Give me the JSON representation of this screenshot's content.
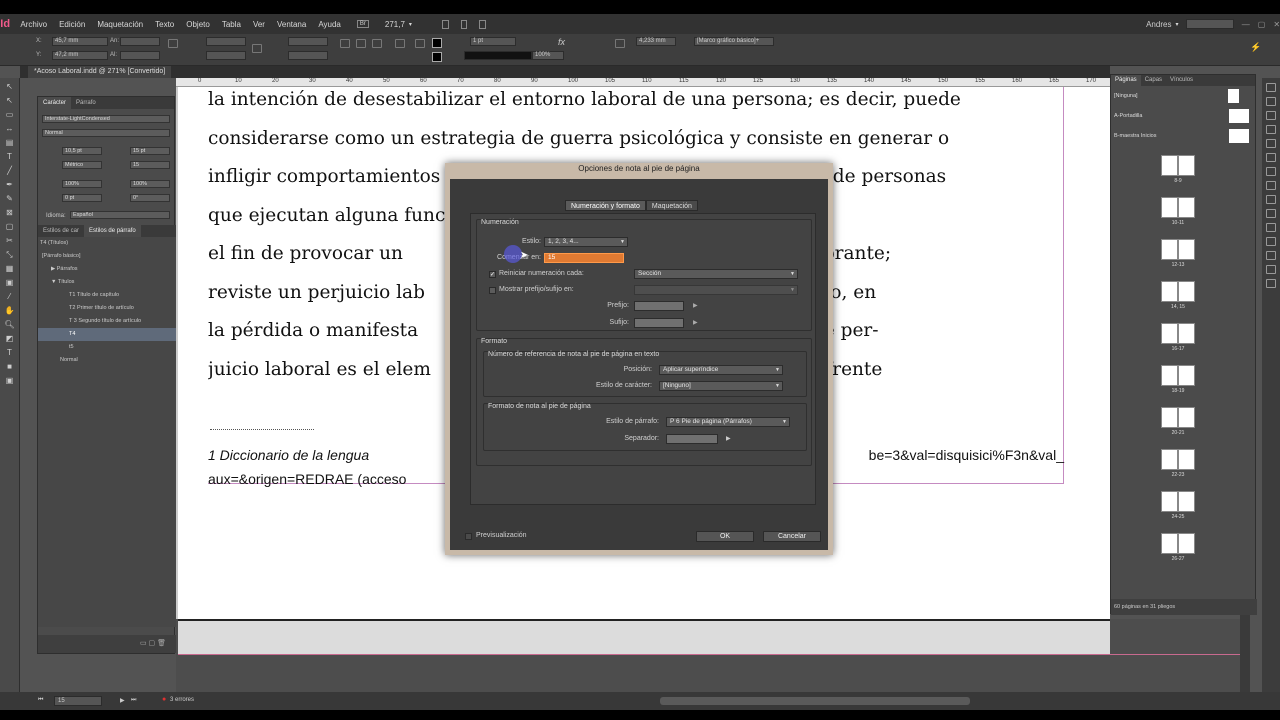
{
  "app": {
    "logo": "Id",
    "user": "Andres",
    "zoom": "271,7"
  },
  "menu": [
    "Archivo",
    "Edición",
    "Maquetación",
    "Texto",
    "Objeto",
    "Tabla",
    "Ver",
    "Ventana",
    "Ayuda"
  ],
  "control": {
    "x_label": "X:",
    "x_value": "45,7 mm",
    "y_label": "Y:",
    "y_value": "47,2 mm",
    "w_label": "An:",
    "h_label": "Al:",
    "stroke_value": "1 pt",
    "opacity_value": "100%",
    "size_value": "4,233 mm",
    "frame_style": "[Marco gráfico básico]+"
  },
  "document_tab": "*Acoso Laboral.indd @ 271% [Convertido]",
  "ruler_ticks": [
    "0",
    "10",
    "20",
    "30",
    "40",
    "50",
    "60",
    "70",
    "80",
    "90",
    "100",
    "105",
    "110",
    "115",
    "120",
    "125",
    "130",
    "135",
    "140",
    "145",
    "150",
    "155",
    "160",
    "165",
    "170"
  ],
  "left_panel": {
    "tab_char": "Carácter",
    "tab_par": "Párrafo",
    "font_family": "Interstate-LightCondensed",
    "font_style": "Normal",
    "font_size": "10,5 pt",
    "leading": "15 pt",
    "kerning": "Métrico",
    "tracking": "15",
    "vscale": "100%",
    "hscale": "100%",
    "baseline": "0 pt",
    "skew": "0°",
    "language_label": "Idioma:",
    "language": "Español",
    "styles_tab_char": "Estilos de car",
    "styles_tab_par": "Estilos de párrafo",
    "current_style": "T4 (Títulos)",
    "styles": [
      {
        "label": "[Párrafo básico]",
        "indent": 0,
        "sel": false
      },
      {
        "label": "▶ Párrafos",
        "indent": 1,
        "sel": false
      },
      {
        "label": "▼ Títulos",
        "indent": 1,
        "sel": false
      },
      {
        "label": "T1 Título de capítulo",
        "indent": 3,
        "sel": false
      },
      {
        "label": "T2 Primer título de artículo",
        "indent": 3,
        "sel": false
      },
      {
        "label": "T 3 Segundo título de artículo",
        "indent": 3,
        "sel": false
      },
      {
        "label": "T4",
        "indent": 3,
        "sel": true
      },
      {
        "label": "t5",
        "indent": 3,
        "sel": false
      },
      {
        "label": "Normal",
        "indent": 2,
        "sel": false
      }
    ]
  },
  "document": {
    "body_lines": [
      "la intención de desestabilizar el entorno laboral de una persona; es decir, puede",
      "considerarse como un estrategia de guerra psicológica y consiste en generar o",
      "infligir comportamientos agresores sobre una persona o un grupo de personas",
      "que ejecutan alguna función                        una célula laboral, con",
      "el fin de provocar un                                              mente desequilibrante;",
      "reviste un perjuicio lab                                          tivación o, incluso, en",
      "la pérdida o manifesta                                            Esta finalidad de per-",
      "juicio laboral es el elem                                         le acoso laboral frente"
    ],
    "footnote_line1": "1  Diccionario  de  la  lengua",
    "footnote_line1_end": "be=3&val=disquisici%F3n&val_",
    "footnote_line2": "aux=&origen=REDRAE (acceso"
  },
  "right_panel": {
    "tab_pages": "Páginas",
    "tab_layers": "Capas",
    "tab_links": "Vínculos",
    "masters": [
      "[Ninguna]",
      "A-Portadilla",
      "B-maestra Inicios"
    ],
    "spreads": [
      "8-9",
      "10-11",
      "12-13",
      "14, 15",
      "16-17",
      "18-19",
      "20-21",
      "22-23",
      "24-25",
      "26-27"
    ],
    "footer": "60 páginas en 31 pliegos"
  },
  "status": {
    "page": "15",
    "errors": "3 errores"
  },
  "dialog": {
    "title": "Opciones de nota al pie de página",
    "tab_numbering": "Numeración y formato",
    "tab_layout": "Maquetación",
    "numbering_group": "Numeración",
    "style_label": "Estilo:",
    "style_value": "1, 2, 3, 4...",
    "start_label": "Comenzar en:",
    "start_value": "15",
    "restart_label": "Reiniciar numeración cada:",
    "restart_value": "Sección",
    "restart_checked": true,
    "show_prefix_label": "Mostrar prefijo/sufijo en:",
    "prefix_label": "Prefijo:",
    "suffix_label": "Sufijo:",
    "format_group": "Formato",
    "ref_group": "Número de referencia de nota al pie de página en texto",
    "position_label": "Posición:",
    "position_value": "Aplicar superíndice",
    "char_style_label": "Estilo de carácter:",
    "char_style_value": "[Ninguno]",
    "note_format_group": "Formato de nota al pie de página",
    "par_style_label": "Estilo de párrafo:",
    "par_style_value": "P 6 Pie de página (Párrafos)",
    "separator_label": "Separador:",
    "preview_label": "Previsualización",
    "ok_label": "OK",
    "cancel_label": "Cancelar"
  }
}
